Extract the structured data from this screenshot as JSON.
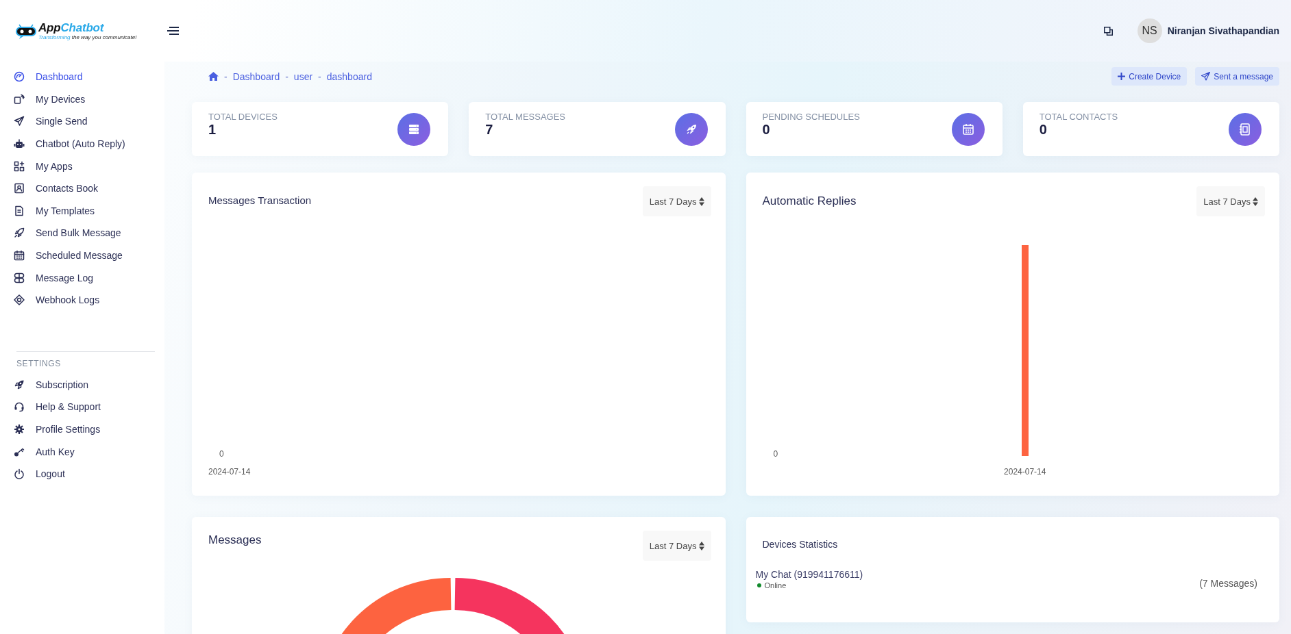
{
  "header": {
    "logo": {
      "name_start": "App",
      "name_end": "Chatbot",
      "tagline_start": "Transforming",
      "tagline_end": "the way you communicate!"
    },
    "user": {
      "initials": "NS",
      "name": "Niranjan Sivathapandian"
    }
  },
  "sidebar": {
    "items": [
      {
        "label": "Dashboard",
        "selected": true
      },
      {
        "label": "My Devices",
        "selected": false
      },
      {
        "label": "Single Send",
        "selected": false
      },
      {
        "label": "Chatbot (Auto Reply)",
        "selected": false
      },
      {
        "label": "My Apps",
        "selected": false
      },
      {
        "label": "Contacts Book",
        "selected": false
      },
      {
        "label": "My Templates",
        "selected": false
      },
      {
        "label": "Send Bulk Message",
        "selected": false
      },
      {
        "label": "Scheduled Message",
        "selected": false
      },
      {
        "label": "Message Log",
        "selected": false
      },
      {
        "label": "Webhook Logs",
        "selected": false
      }
    ],
    "settings_heading": "SETTINGS",
    "settings_items": [
      {
        "label": "Subscription",
        "selected": false
      },
      {
        "label": "Help & Support",
        "selected": false
      },
      {
        "label": "Profile Settings",
        "selected": false
      },
      {
        "label": "Auth Key",
        "selected": false
      },
      {
        "label": "Logout",
        "selected": false
      }
    ]
  },
  "breadcrumb": [
    {
      "separator": "-",
      "label": "Dashboard"
    },
    {
      "separator": "-",
      "label": "user"
    },
    {
      "separator": "-",
      "label": "dashboard"
    }
  ],
  "actions": [
    {
      "kind": "create",
      "label": "Create Device"
    },
    {
      "kind": "send",
      "label": "Sent a message"
    }
  ],
  "stats": [
    {
      "label": "TOTAL DEVICES",
      "value": "1"
    },
    {
      "label": "TOTAL MESSAGES",
      "value": "7"
    },
    {
      "label": "PENDING SCHEDULES",
      "value": "0"
    },
    {
      "label": "TOTAL CONTACTS",
      "value": "0"
    }
  ],
  "panels": [
    {
      "kind": "empty-chart",
      "title": "Messages Transaction",
      "filter": "Last 7 Days",
      "y_tick": "0",
      "x_label": "2024-07-14"
    },
    {
      "kind": "bar-chart",
      "title": "Automatic Replies",
      "filter": "Last 7 Days",
      "y_tick": "0",
      "x_label": "2024-07-14"
    },
    {
      "kind": "donut-chart",
      "title": "Messages",
      "filter": "Last 7 Days"
    },
    {
      "kind": "device-list",
      "title": "Devices Statistics",
      "devices": [
        {
          "name": "My Chat (919941176611)",
          "status": "Online",
          "online": true,
          "count": "(7 Messages)"
        }
      ]
    }
  ]
}
